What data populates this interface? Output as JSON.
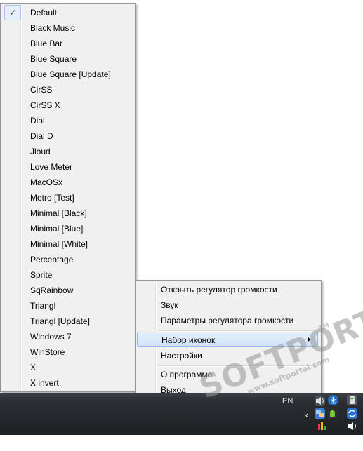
{
  "skin_menu": {
    "items": [
      {
        "label": "Default",
        "checked": true
      },
      {
        "label": "Black Music"
      },
      {
        "label": "Blue Bar"
      },
      {
        "label": "Blue Square"
      },
      {
        "label": "Blue Square [Update]"
      },
      {
        "label": "CirSS"
      },
      {
        "label": "CirSS X"
      },
      {
        "label": "Dial"
      },
      {
        "label": "Dial D"
      },
      {
        "label": "Jloud"
      },
      {
        "label": "Love Meter"
      },
      {
        "label": "MacOSx"
      },
      {
        "label": "Metro [Test]"
      },
      {
        "label": "Minimal [Black]"
      },
      {
        "label": "Minimal [Blue]"
      },
      {
        "label": "Minimal [White]"
      },
      {
        "label": "Percentage"
      },
      {
        "label": "Sprite"
      },
      {
        "label": "SqRainbow"
      },
      {
        "label": "Triangl"
      },
      {
        "label": "Triangl [Update]"
      },
      {
        "label": "Windows 7"
      },
      {
        "label": "WinStore"
      },
      {
        "label": "X"
      },
      {
        "label": "X invert"
      }
    ],
    "check_glyph": "✓"
  },
  "context_menu": {
    "open_mixer": "Открыть регулятор громкости",
    "sound": "Звук",
    "volume_settings": "Параметры регулятора громкости",
    "icon_set": "Набор иконок",
    "settings": "Настройки",
    "about": "О программе",
    "exit": "Выход"
  },
  "taskbar": {
    "language": "EN",
    "show_hidden_icons_glyph": "‹"
  },
  "watermark": {
    "brand": "SOFTPORTAL",
    "site": "www.softportal.com",
    "tm": "TM"
  },
  "colors": {
    "menu_bg": "#f0f0f0",
    "highlight": "#cfe3fa",
    "taskbar": "#2a2d31"
  }
}
